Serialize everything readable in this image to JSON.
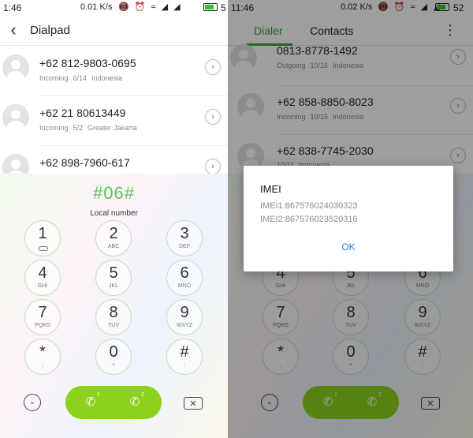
{
  "left": {
    "status": {
      "time": "1:46",
      "speed": "0.01 K/s",
      "icons": "📵 ⏰ ≈ ◢ ◢",
      "battery_level": "5"
    },
    "header": {
      "title": "Dialpad"
    },
    "calls": [
      {
        "number": "+62 812-9803-0695",
        "type": "Incoming",
        "date": "6/14",
        "location": "Indonesia"
      },
      {
        "number": "+62 21 80613449",
        "type": "Incoming",
        "date": "5/2",
        "location": "Greater Jakarta"
      },
      {
        "number": "+62 898-7960-617",
        "type": "",
        "date": "",
        "location": ""
      }
    ],
    "dialpad": {
      "display": "#06#",
      "label": "Local number",
      "keys": [
        {
          "digit": "1",
          "letters": ""
        },
        {
          "digit": "2",
          "letters": "ABC"
        },
        {
          "digit": "3",
          "letters": "DEF"
        },
        {
          "digit": "4",
          "letters": "GHI"
        },
        {
          "digit": "5",
          "letters": "JKL"
        },
        {
          "digit": "6",
          "letters": "MNO"
        },
        {
          "digit": "7",
          "letters": "PQRS"
        },
        {
          "digit": "8",
          "letters": "TUV"
        },
        {
          "digit": "9",
          "letters": "WXYZ"
        },
        {
          "digit": "*",
          "letters": ","
        },
        {
          "digit": "0",
          "letters": "+"
        },
        {
          "digit": "#",
          "letters": ";"
        }
      ],
      "sim1": "1",
      "sim2": "2"
    }
  },
  "right": {
    "status": {
      "time": "11:46",
      "speed": "0.02 K/s",
      "icons": "📵 ⏰ ≈ ◢ ◢",
      "battery_level": "52"
    },
    "tabs": [
      {
        "label": "Dialer"
      },
      {
        "label": "Contacts"
      }
    ],
    "calls": [
      {
        "number": "0813-8778-1492",
        "type": "Outgoing",
        "date": "10/16",
        "location": "Indonesia"
      },
      {
        "number": "+62 858-8850-8023",
        "type": "Incoming",
        "date": "10/15",
        "location": "Indonesia"
      },
      {
        "number": "+62 838-7745-2030",
        "type": "",
        "date": "10/11",
        "location": "Indonesia"
      }
    ],
    "dialog": {
      "title": "IMEI",
      "imei1": "IMEI1:867576024030323",
      "imei2": "IMEI2:867576023520316",
      "ok": "OK"
    }
  },
  "colors": {
    "accent_green": "#5cc35a",
    "call_green": "#8cd21c",
    "ok_blue": "#2b7be0"
  },
  "icons": [
    "back-arrow-icon",
    "chevron-right-icon",
    "avatar-icon",
    "voicemail-icon",
    "collapse-icon",
    "phone-icon",
    "backspace-icon",
    "more-vert-icon"
  ]
}
